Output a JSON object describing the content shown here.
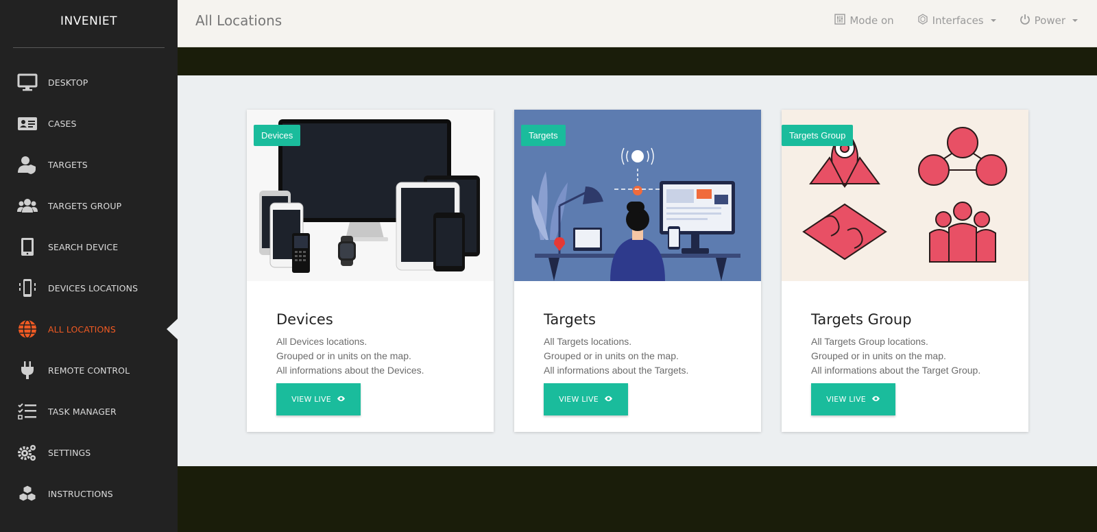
{
  "app": {
    "brand": "INVENIET"
  },
  "header": {
    "title": "All Locations",
    "mode": "Mode on",
    "interfaces": "Interfaces",
    "power": "Power"
  },
  "sidebar": {
    "items": [
      {
        "label": "DESKTOP",
        "icon": "monitor-icon"
      },
      {
        "label": "CASES",
        "icon": "id-card-icon"
      },
      {
        "label": "TARGETS",
        "icon": "user-shield-icon"
      },
      {
        "label": "TARGETS GROUP",
        "icon": "users-icon"
      },
      {
        "label": "SEARCH DEVICE",
        "icon": "tablet-icon"
      },
      {
        "label": "DEVICES LOCATIONS",
        "icon": "vibrating-phone-icon"
      },
      {
        "label": "ALL LOCATIONS",
        "icon": "globe-icon",
        "active": true
      },
      {
        "label": "REMOTE CONTROL",
        "icon": "plug-icon"
      },
      {
        "label": "TASK MANAGER",
        "icon": "tasks-icon"
      },
      {
        "label": "SETTINGS",
        "icon": "gears-icon"
      },
      {
        "label": "INSTRUCTIONS",
        "icon": "cubes-icon"
      }
    ]
  },
  "cards": [
    {
      "tag": "Devices",
      "title": "Devices",
      "lines": [
        "All Devices locations.",
        "Grouped or in units on the map.",
        "All informations about the Devices."
      ],
      "button": "VIEW LIVE"
    },
    {
      "tag": "Targets",
      "title": "Targets",
      "lines": [
        "All Targets locations.",
        "Grouped or in units on the map.",
        "All informations about the Targets."
      ],
      "button": "VIEW LIVE"
    },
    {
      "tag": "Targets Group",
      "title": "Targets Group",
      "lines": [
        "All Targets Group locations.",
        "Grouped or in units on the map.",
        "All informations about the Target Group."
      ],
      "button": "VIEW LIVE"
    }
  ],
  "colors": {
    "accent": "#1abc9c",
    "active": "#f05a23",
    "sidebar": "#222222",
    "band": "#1a1d0a"
  }
}
